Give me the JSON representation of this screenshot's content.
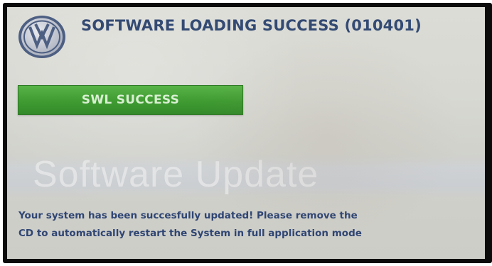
{
  "header": {
    "title": "SOFTWARE LOADING SUCCESS (010401)",
    "logo": "vw-logo"
  },
  "status_button": {
    "label": "SWL SUCCESS",
    "color": "#3f9b32"
  },
  "watermark": {
    "text": "Software Update"
  },
  "message": {
    "line1": "Your system has been succesfully updated! Please remove the",
    "line2": "CD to automatically restart the System in full application mode"
  },
  "colors": {
    "title_text": "#334a73",
    "message_text": "#2f4573",
    "screen_background": "#d7d8d2"
  }
}
